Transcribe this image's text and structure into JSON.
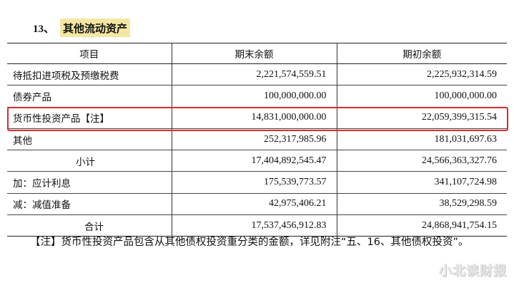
{
  "section": {
    "number": "13、",
    "title": "其他流动资产"
  },
  "table": {
    "headers": [
      "项目",
      "期末余额",
      "期初余额"
    ],
    "rows": [
      {
        "label": "待抵扣进项税及预缴税费",
        "end": "2,221,574,559.51",
        "begin": "2,225,932,314.59"
      },
      {
        "label": "债券产品",
        "end": "100,000,000.00",
        "begin": "100,000,000.00"
      },
      {
        "label": "货币性投资产品【注】",
        "end": "14,831,000,000.00",
        "begin": "22,059,399,315.54"
      },
      {
        "label": "其他",
        "end": "252,317,985.96",
        "begin": "181,031,697.63"
      },
      {
        "label": "小计",
        "end": "17,404,892,545.47",
        "begin": "24,566,363,327.76"
      },
      {
        "label": "加：应计利息",
        "end": "175,539,773.57",
        "begin": "341,107,724.98"
      },
      {
        "label": "减：减值准备",
        "end": "42,975,406.21",
        "begin": "38,529,298.59"
      },
      {
        "label": "合计",
        "end": "17,537,456,912.83",
        "begin": "24,868,941,754.15"
      }
    ]
  },
  "note": "【注】货币性投资产品包含从其他债权投资重分类的金额，详见附注“五、16、其他债权投资”。",
  "watermark": "小北读财报",
  "colors": {
    "highlight_border": "#e0272d",
    "title_highlight": "#f3e7a2"
  }
}
